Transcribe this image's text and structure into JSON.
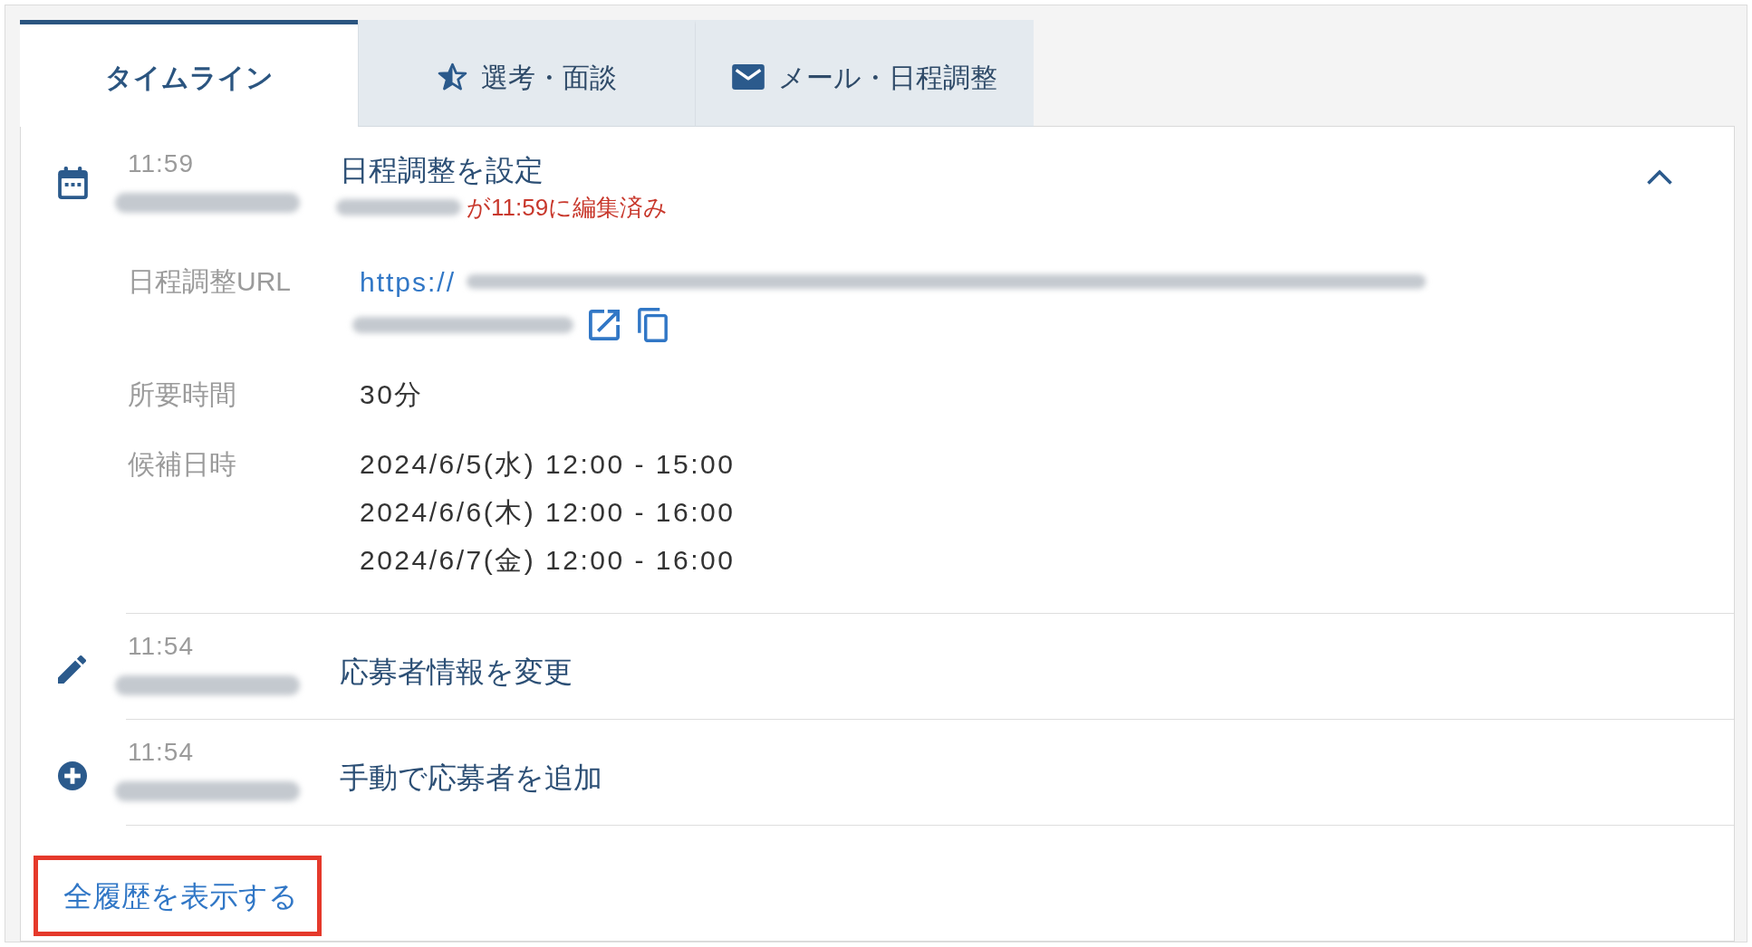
{
  "tabs": [
    {
      "label": "タイムライン",
      "selected": true
    },
    {
      "label": "選考・面談",
      "selected": false
    },
    {
      "label": "メール・日程調整",
      "selected": false
    }
  ],
  "timeline": [
    {
      "kind": "schedule",
      "time": "11:59",
      "author_redacted": true,
      "title": "日程調整を設定",
      "edit_note": {
        "editor_redacted": true,
        "text": "が11:59に編集済み"
      },
      "expanded": true,
      "details": [
        {
          "kind": "url",
          "label": "日程調整URL",
          "link": "https://",
          "link_rest_redacted": true
        },
        {
          "kind": "text",
          "label": "所要時間",
          "lines": [
            "30分"
          ]
        },
        {
          "kind": "text",
          "label": "候補日時",
          "lines": [
            "2024/6/5(水) 12:00 - 15:00",
            "2024/6/6(木) 12:00 - 16:00",
            "2024/6/7(金) 12:00 - 16:00"
          ]
        }
      ]
    },
    {
      "kind": "edit",
      "time": "11:54",
      "author_redacted": true,
      "title": "応募者情報を変更"
    },
    {
      "kind": "add",
      "time": "11:54",
      "author_redacted": true,
      "title": "手動で応募者を追加"
    }
  ],
  "show_all_link": {
    "label": "全履歴を表示する",
    "highlighted": true
  }
}
